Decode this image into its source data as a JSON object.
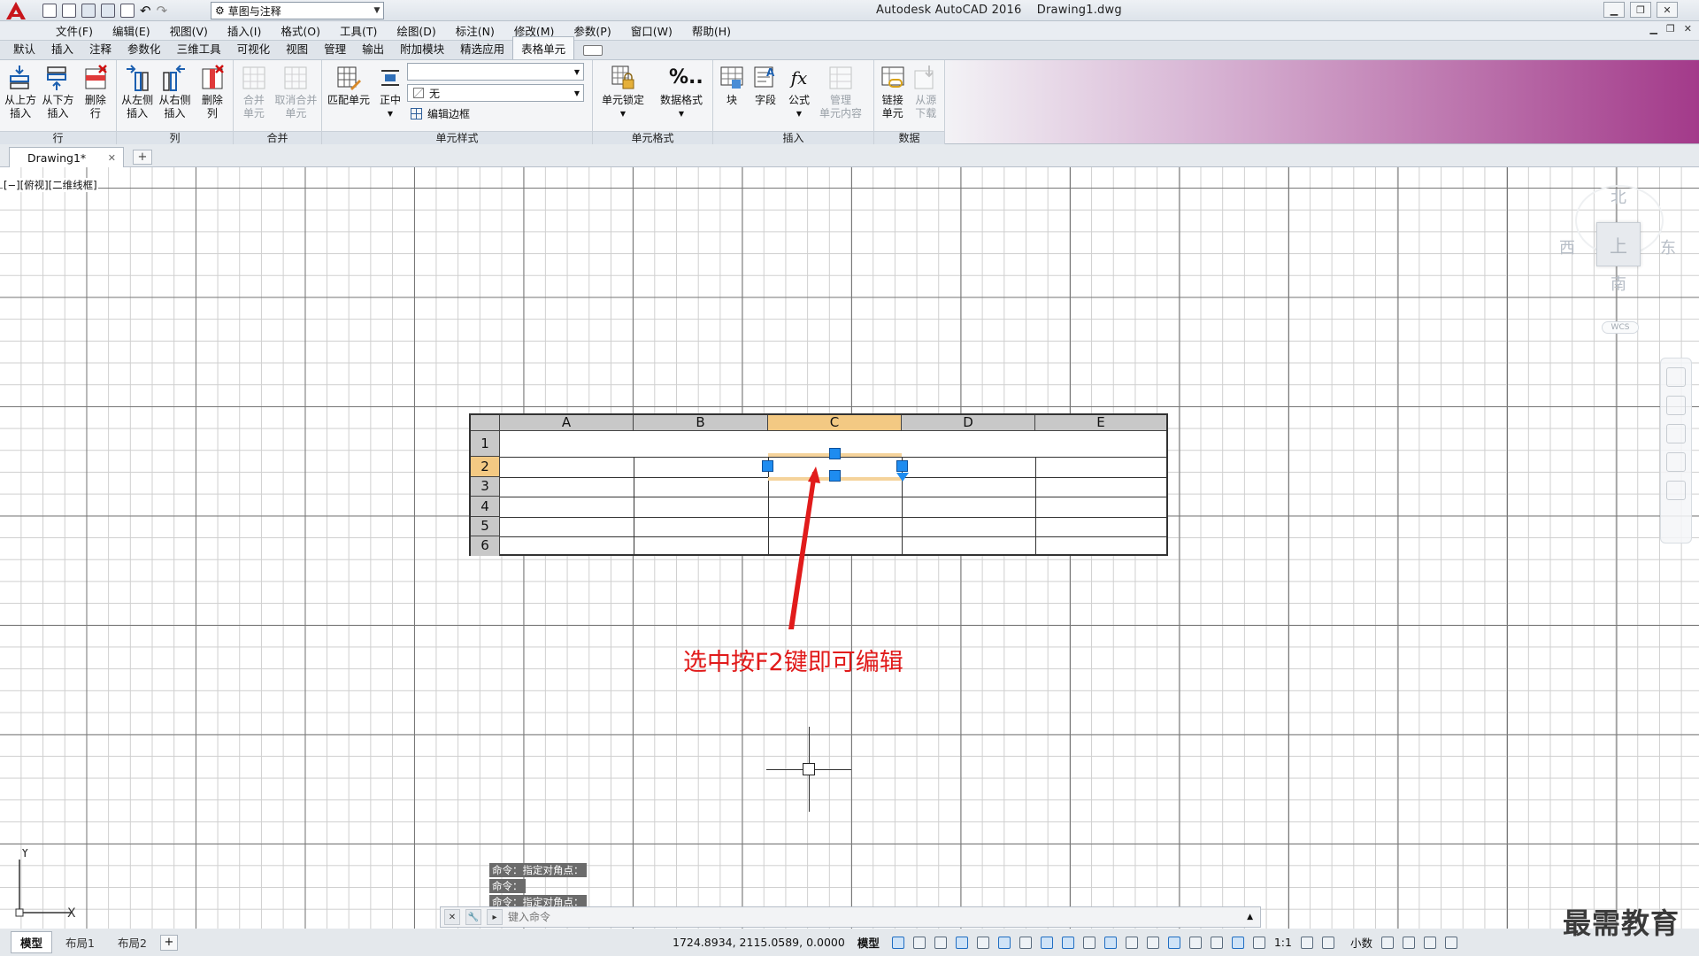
{
  "title_bar": {
    "app_title": "Autodesk AutoCAD 2016",
    "file_name": "Drawing1.dwg",
    "workspace": "草图与注释"
  },
  "menu": [
    "文件(F)",
    "编辑(E)",
    "视图(V)",
    "插入(I)",
    "格式(O)",
    "工具(T)",
    "绘图(D)",
    "标注(N)",
    "修改(M)",
    "参数(P)",
    "窗口(W)",
    "帮助(H)"
  ],
  "ribbon_tabs": [
    "默认",
    "插入",
    "注释",
    "参数化",
    "三维工具",
    "可视化",
    "视图",
    "管理",
    "输出",
    "附加模块",
    "精选应用",
    "表格单元"
  ],
  "active_ribbon_tab": "表格单元",
  "ribbon": {
    "rows_panel": {
      "title": "行",
      "buttons": [
        {
          "line1": "从上方",
          "line2": "插入"
        },
        {
          "line1": "从下方",
          "line2": "插入"
        },
        {
          "line1": "删除",
          "line2": "行"
        }
      ]
    },
    "cols_panel": {
      "title": "列",
      "buttons": [
        {
          "line1": "从左侧",
          "line2": "插入"
        },
        {
          "line1": "从右侧",
          "line2": "插入"
        },
        {
          "line1": "删除",
          "line2": "列"
        }
      ]
    },
    "merge_panel": {
      "title": "合并",
      "buttons": [
        {
          "line1": "合并",
          "line2": "单元"
        },
        {
          "line1": "取消合并",
          "line2": "单元"
        }
      ]
    },
    "cell_style_panel": {
      "title": "单元样式",
      "match_cell": "匹配单元",
      "align": "正中",
      "style_combo": "",
      "fill_combo": "无",
      "edit_borders": "编辑边框"
    },
    "cell_format_panel": {
      "title": "单元格式",
      "cell_lock": "单元锁定",
      "data_format": "数据格式"
    },
    "insert_panel": {
      "title": "插入",
      "block": "块",
      "field": "字段",
      "formula": "公式",
      "manage_line1": "管理",
      "manage_line2": "单元内容"
    },
    "data_panel": {
      "title": "数据",
      "link_line1": "链接",
      "link_line2": "单元",
      "download_line1": "从源",
      "download_line2": "下载"
    }
  },
  "doc_tab": {
    "name": "Drawing1*"
  },
  "viewport_label": "[−][俯视][二维线框]",
  "table": {
    "columns": [
      "A",
      "B",
      "C",
      "D",
      "E"
    ],
    "rows": [
      "1",
      "2",
      "3",
      "4",
      "5",
      "6"
    ],
    "selected_column": "C",
    "selected_row": "2"
  },
  "annotation": "选中按F2键即可编辑",
  "viewcube": {
    "north": "北",
    "south": "南",
    "east": "东",
    "west": "西",
    "top": "上",
    "wcs": "WCS"
  },
  "ucs": {
    "x": "X",
    "y": "Y"
  },
  "command": {
    "history": [
      "命令：指定对角点：",
      "命令：",
      "命令：指定对角点："
    ],
    "placeholder": "键入命令"
  },
  "layout_tabs": [
    "模型",
    "布局1",
    "布局2"
  ],
  "status": {
    "coords": "1724.8934, 2115.0589, 0.0000",
    "model": "模型",
    "scale": "1:1",
    "units": "小数"
  },
  "watermark": "最需教育",
  "colors": {
    "selection_header": "#f3c983",
    "grip": "#1e8cf0",
    "annotation": "#e11b1b"
  }
}
